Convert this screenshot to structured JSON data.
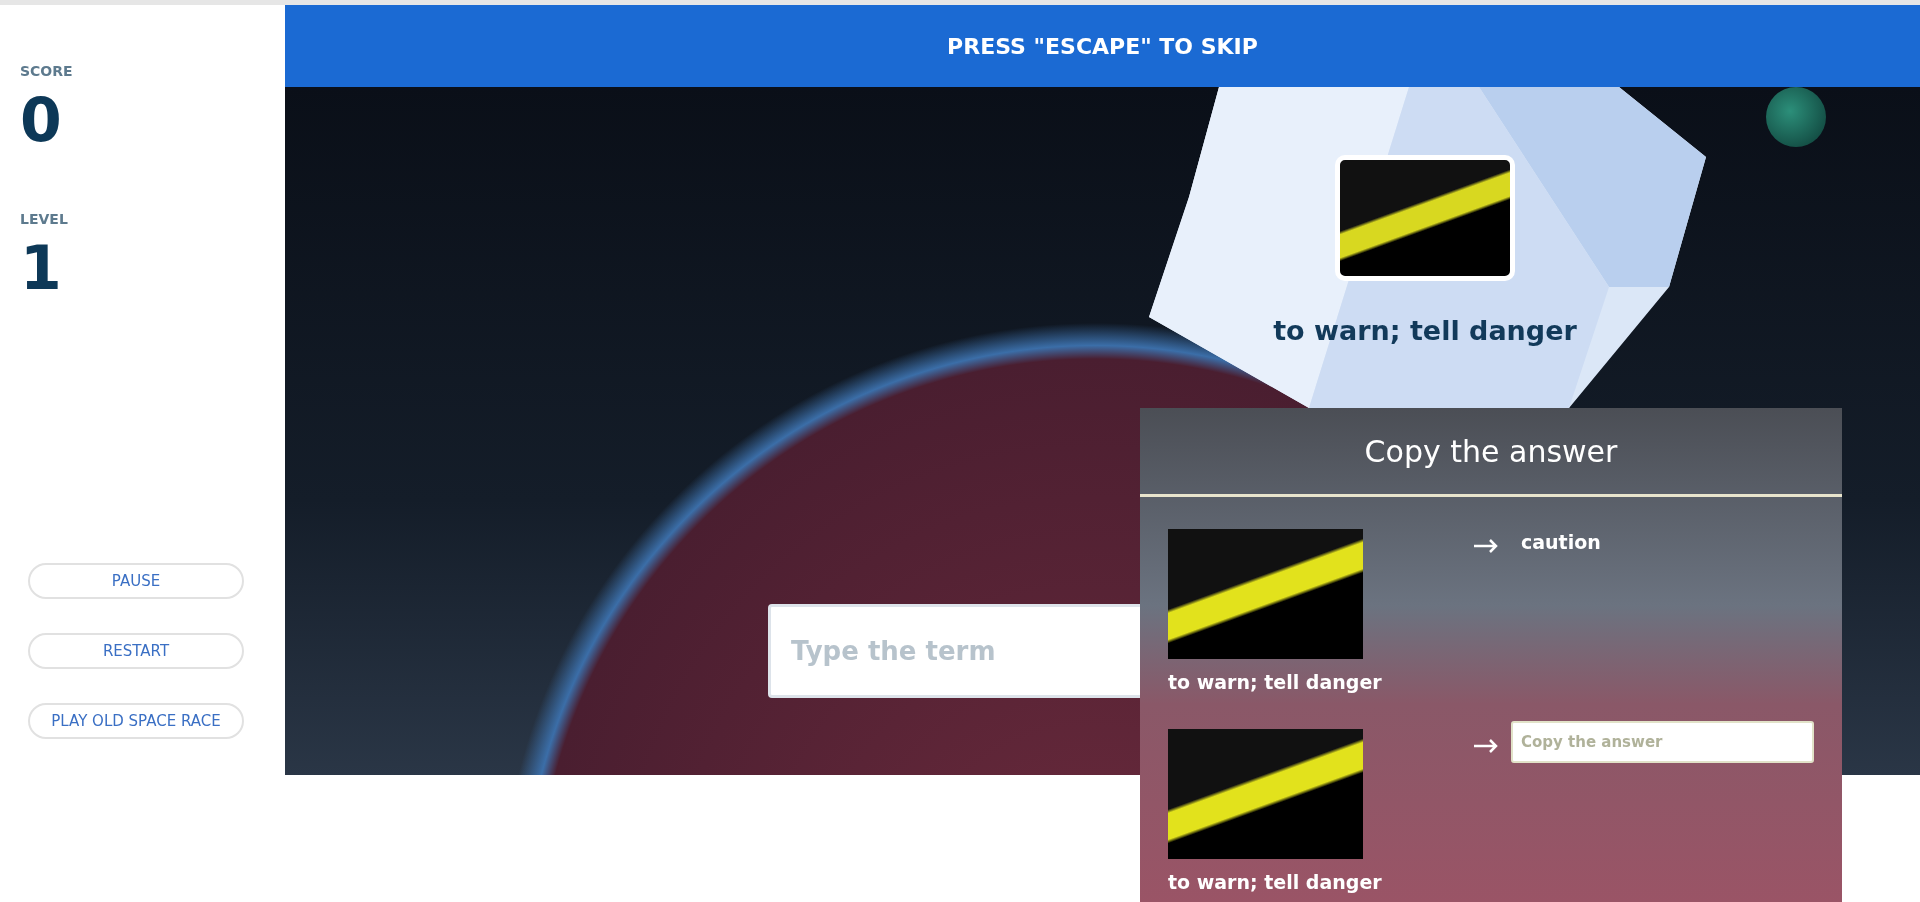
{
  "sidebar": {
    "score_label": "SCORE",
    "score": "0",
    "level_label": "LEVEL",
    "level": "1",
    "buttons": [
      "PAUSE",
      "RESTART",
      "PLAY OLD SPACE RACE"
    ]
  },
  "banner": {
    "text": "PRESS \"ESCAPE\" TO SKIP"
  },
  "asteroid": {
    "definition": "to warn; tell danger"
  },
  "answer_field": {
    "placeholder": "Type the term"
  },
  "copy_panel": {
    "title": "Copy the answer",
    "rows": [
      {
        "kind": "answer",
        "definition": "to warn; tell danger",
        "term": "caution"
      },
      {
        "kind": "input",
        "definition": "to warn; tell danger",
        "placeholder": "Copy the answer"
      }
    ]
  }
}
